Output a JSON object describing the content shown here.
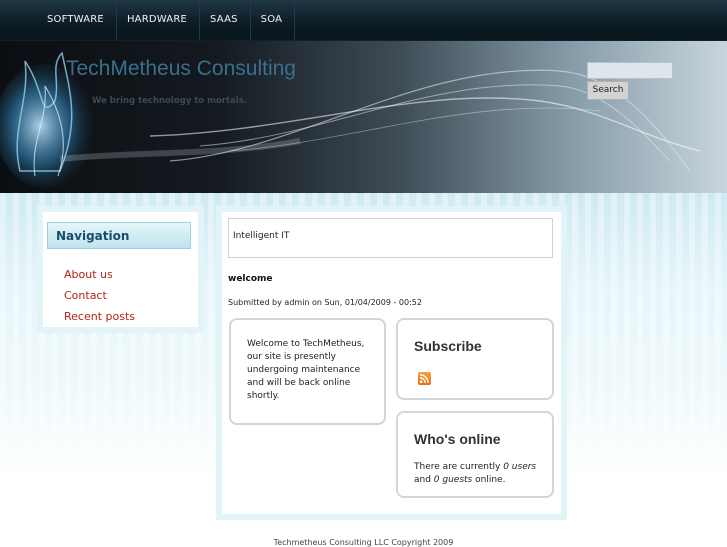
{
  "nav": {
    "items": [
      {
        "label": "SOFTWARE"
      },
      {
        "label": "HARDWARE"
      },
      {
        "label": "SAAS"
      },
      {
        "label": "SOA"
      }
    ]
  },
  "header": {
    "site_name": "TechMetheus Consulting",
    "slogan": "We bring technology to mortals.",
    "search_placeholder": "",
    "search_button": "Search"
  },
  "sidebar": {
    "title": "Navigation",
    "items": [
      {
        "label": "About us"
      },
      {
        "label": "Contact"
      },
      {
        "label": "Recent posts"
      }
    ]
  },
  "main": {
    "mission": "Intelligent IT",
    "node_title": "welcome",
    "submitted": "Submitted by admin on Sun, 01/04/2009 - 00:52",
    "welcome_text": "Welcome to TechMetheus, our site is presently undergoing maintenance and will be back online shortly.",
    "subscribe_title": "Subscribe",
    "rss_icon": "rss-feed-icon",
    "whos_online_title": "Who's online",
    "online_prefix": "There are currently ",
    "online_users": "0 users",
    "online_and": " and ",
    "online_guests": "0 guests",
    "online_suffix": " online."
  },
  "footer": {
    "text": "Techmetheus Consulting LLC Copyright 2009"
  },
  "colors": {
    "link": "#b42318",
    "nav_bg": "#0d1b24",
    "title_blue": "#3a6f8f"
  }
}
